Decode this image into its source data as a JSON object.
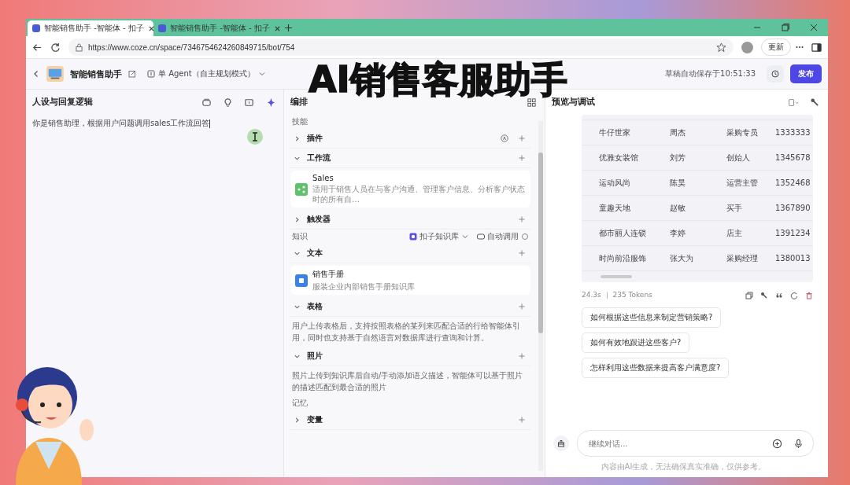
{
  "browser": {
    "tabs": [
      {
        "title": "智能销售助手 -智能体 - 扣子",
        "selected": true
      },
      {
        "title": "智能销售助手 -智能体 - 扣子",
        "selected": false
      }
    ],
    "url": "https://www.coze.cn/space/7346754624260849715/bot/754",
    "update_button": "更新"
  },
  "overlay_title": "AI销售客服助手",
  "header": {
    "bot_name": "智能销售助手",
    "mode": "单 Agent（自主规划模式）",
    "autosave": "草稿自动保存于10:51:33",
    "publish_button": "发布"
  },
  "persona": {
    "title": "人设与回复逻辑",
    "prompt": "你是销售助理，根据用户问题调用sales工作流回答"
  },
  "arrange": {
    "title": "编排",
    "blocks": [
      {
        "kind": "group",
        "label": "技能"
      },
      {
        "kind": "section",
        "label": "插件",
        "expanded": false,
        "auto": true
      },
      {
        "kind": "section",
        "label": "工作流",
        "expanded": true
      },
      {
        "kind": "workflow",
        "name": "Sales",
        "desc": "适用于销售人员在与客户沟通、管理客户信息、分析客户状态时的所有自…"
      },
      {
        "kind": "section",
        "label": "触发器",
        "expanded": false
      },
      {
        "kind": "group",
        "label": "知识",
        "source": "扣子知识库",
        "call": "自动调用"
      },
      {
        "kind": "section",
        "label": "文本",
        "expanded": true
      },
      {
        "kind": "knowledge",
        "name": "销售手册",
        "desc": "服装企业内部销售手册知识库"
      },
      {
        "kind": "section",
        "label": "表格",
        "expanded": true
      },
      {
        "kind": "text",
        "text": "用户上传表格后，支持按照表格的某列来匹配合适的行给智能体引用，同时也支持基于自然语言对数据库进行查询和计算。"
      },
      {
        "kind": "section",
        "label": "照片",
        "expanded": true
      },
      {
        "kind": "text",
        "text": "照片上传到知识库后自动/手动添加语义描述，智能体可以基于照片的描述匹配到最合适的照片"
      },
      {
        "kind": "group",
        "label": "记忆"
      },
      {
        "kind": "section",
        "label": "变量",
        "expanded": false
      }
    ]
  },
  "preview": {
    "title": "预览与调试",
    "table_rows": [
      [
        "牛仔世家",
        "周杰",
        "采购专员",
        "1333333"
      ],
      [
        "优雅女装馆",
        "刘芳",
        "创始人",
        "1345678"
      ],
      [
        "运动风尚",
        "陈昊",
        "运营主管",
        "1352468"
      ],
      [
        "童趣天地",
        "赵敏",
        "买手",
        "1367890"
      ],
      [
        "都市丽人连锁",
        "李婷",
        "店主",
        "1391234"
      ],
      [
        "时尚前沿服饰",
        "张大为",
        "采购经理",
        "1380013"
      ]
    ],
    "stats": "24.3s ｜ 235 Tokens",
    "suggestions": [
      "如何根据这些信息来制定营销策略?",
      "如何有效地跟进这些客户?",
      "怎样利用这些数据来提高客户满意度?"
    ],
    "input_placeholder": "继续对话...",
    "disclaimer": "内容由AI生成，无法确保真实准确，仅供参考。"
  }
}
